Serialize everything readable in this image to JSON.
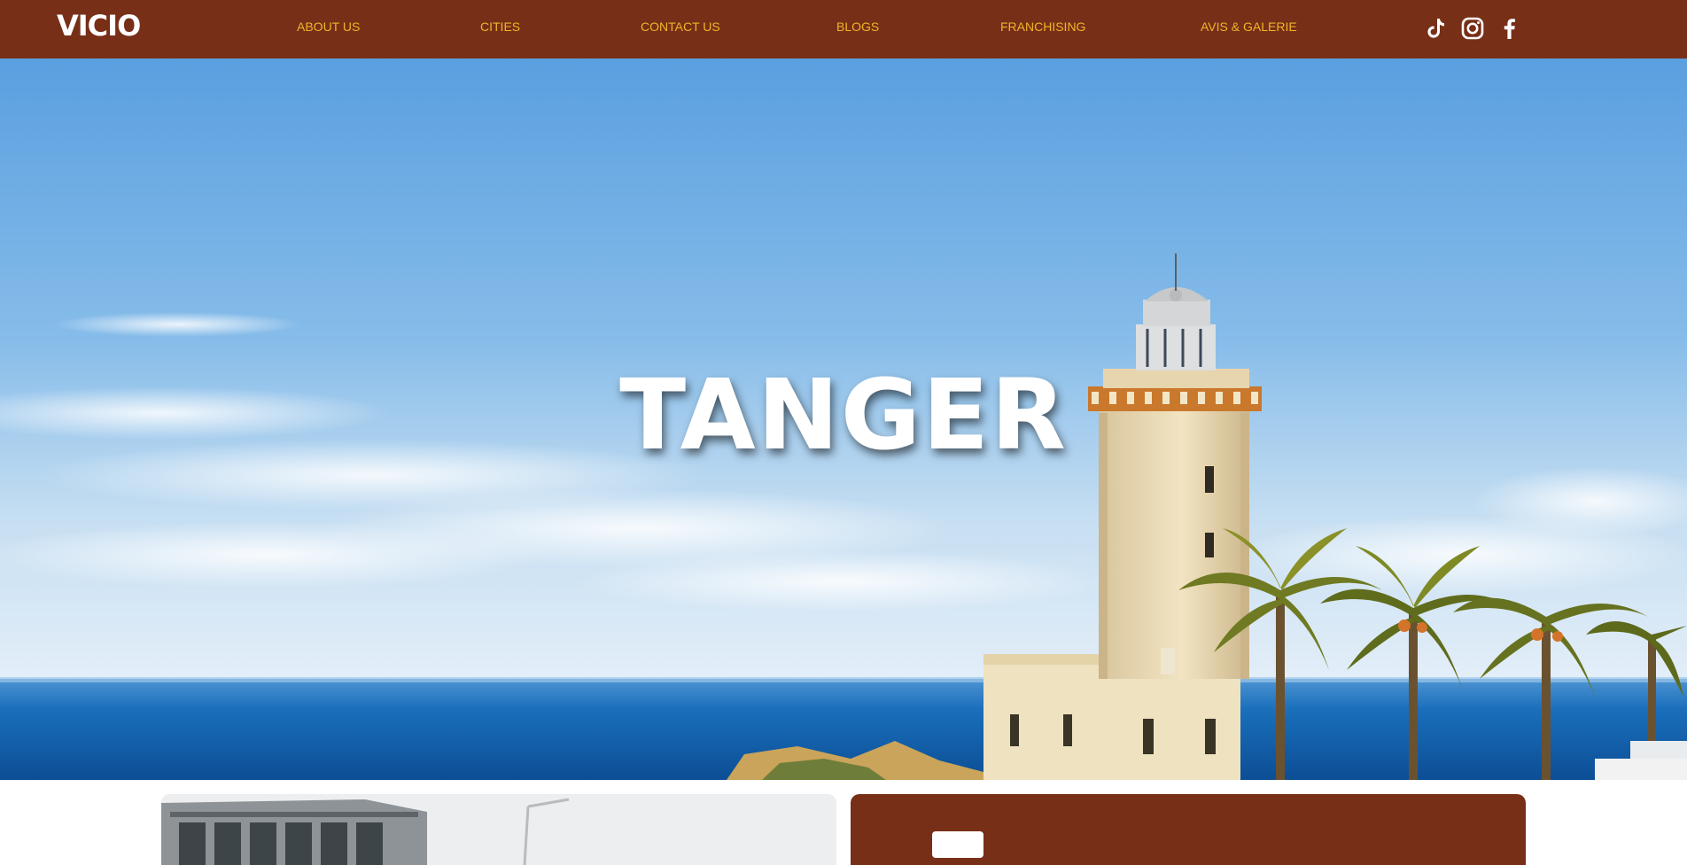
{
  "brand": {
    "logo": "VICIO"
  },
  "nav": {
    "about": "ABOUT US",
    "cities": "CITIES",
    "contact": "CONTACT US",
    "blogs": "BLOGS",
    "franchising": "FRANCHISING",
    "avis": "AVIS & GALERIE"
  },
  "social": {
    "tiktok": "tiktok-icon",
    "instagram": "instagram-icon",
    "facebook": "facebook-icon"
  },
  "hero": {
    "title": "TANGER"
  },
  "colors": {
    "navbar": "#772f17",
    "nav_link": "#f0b429",
    "text_light": "#ffffff"
  }
}
